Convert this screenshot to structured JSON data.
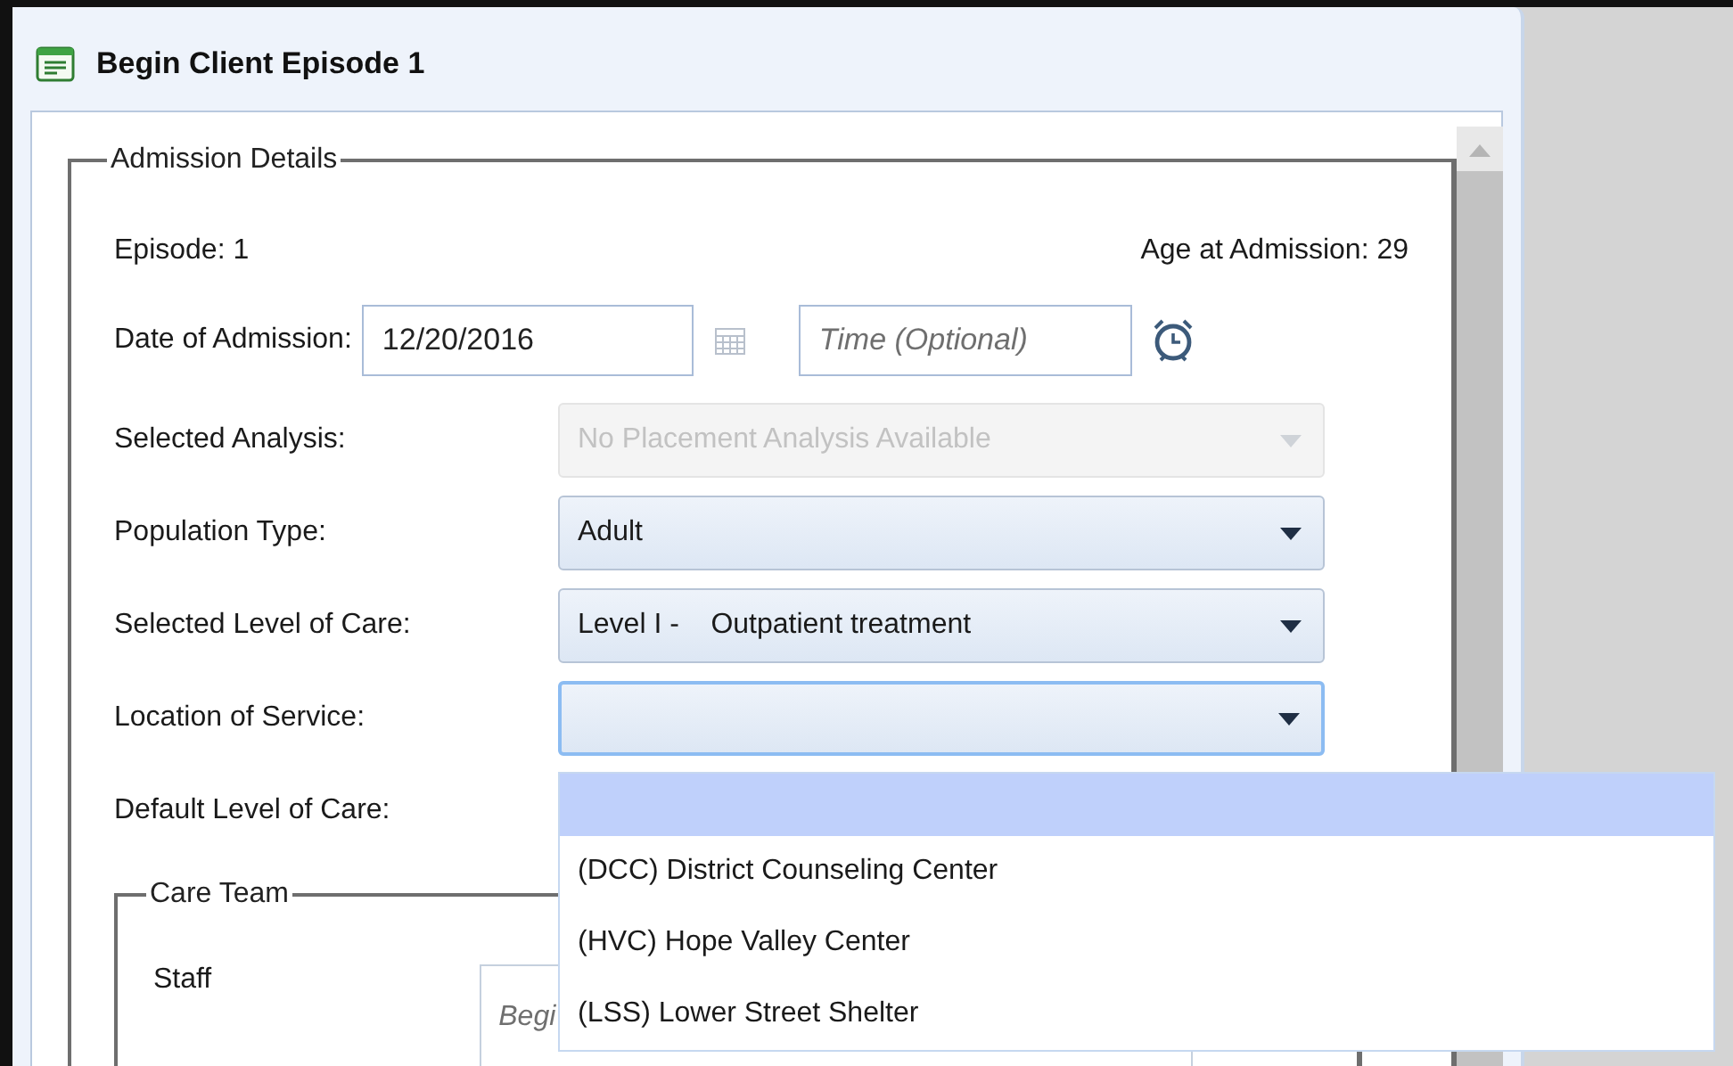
{
  "window": {
    "title": "Begin Client Episode 1"
  },
  "admission_details": {
    "title": "Admission Details",
    "episode": "Episode: 1",
    "age": "Age at Admission: 29",
    "date_label": "Date of Admission:",
    "date_value": "12/20/2016",
    "time_placeholder": "Time (Optional)",
    "fields": [
      {
        "label": "Selected Analysis:",
        "value": "No Placement Analysis Available",
        "disabled": true,
        "focused": false
      },
      {
        "label": "Population Type:",
        "value": "Adult",
        "disabled": false,
        "focused": false
      },
      {
        "label": "Selected Level of Care:",
        "value": "Level I -    Outpatient treatment",
        "disabled": false,
        "focused": false
      },
      {
        "label": "Location of Service:",
        "disabled": false,
        "focused": true
      }
    ],
    "default_level_label": "Default Level of Care:"
  },
  "care_team": {
    "title": "Care Team",
    "staff_label": "Staff",
    "staff_placeholder": "Begi"
  },
  "dropdown": {
    "items": [
      {
        "selected": true
      },
      {
        "label": "(DCC) District Counseling Center",
        "selected": false
      },
      {
        "label": "(HVC) Hope Valley Center",
        "selected": false
      },
      {
        "label": "(LSS) Lower Street Shelter",
        "selected": false
      }
    ]
  }
}
